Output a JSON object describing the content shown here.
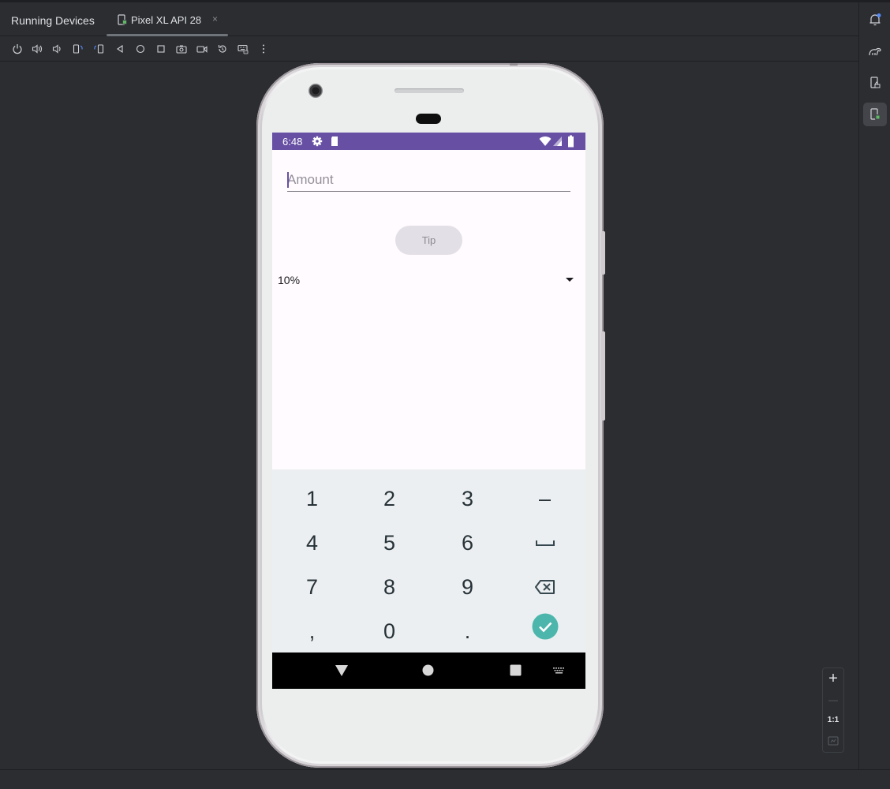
{
  "tool_window": {
    "title": "Running Devices",
    "tab": {
      "label": "Pixel XL API 28",
      "close": "×"
    }
  },
  "toolbar": {
    "buttons": [
      "power-icon",
      "volume-up-icon",
      "volume-down-icon",
      "rotate-left-icon",
      "rotate-right-icon",
      "back-icon",
      "home-icon",
      "overview-icon",
      "screenshot-icon",
      "screen-record-icon",
      "reset-icon",
      "keyboard-icon",
      "more-icon"
    ]
  },
  "right_strip": {
    "buttons": [
      "notifications-icon",
      "gradle-icon",
      "device-manager-icon",
      "running-devices-icon"
    ]
  },
  "zoom": {
    "in": "+",
    "out": "—",
    "actual": "1:1"
  },
  "device": {
    "status_bar": {
      "time": "6:48",
      "color": "#6750a4"
    },
    "app": {
      "amount_placeholder": "Amount",
      "amount_value": "",
      "tip_button": "Tip",
      "spinner_value": "10%"
    },
    "keyboard": {
      "keys": [
        "1",
        "2",
        "3",
        "–",
        "4",
        "5",
        "6",
        "␣",
        "7",
        "8",
        "9",
        "⌫",
        ",",
        "0",
        ".",
        "✓"
      ]
    }
  }
}
